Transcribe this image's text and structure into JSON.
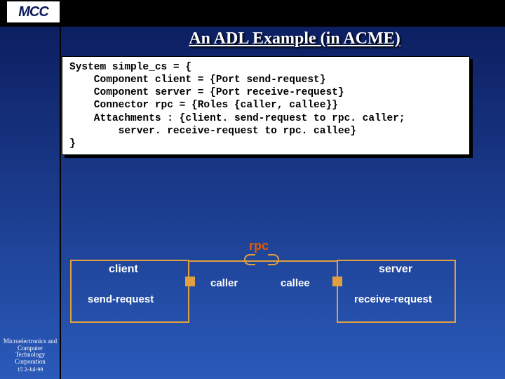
{
  "logo": "MCC",
  "title": "An ADL Example (in ACME)",
  "code": "System simple_cs = {\n    Component client = {Port send-request}\n    Component server = {Port receive-request}\n    Connector rpc = {Roles {caller, callee}}\n    Attachments : {client. send-request to rpc. caller;\n        server. receive-request to rpc. callee}\n}",
  "diagram": {
    "rpc": "rpc",
    "client": "client",
    "server": "server",
    "send": "send-request",
    "receive": "receive-request",
    "caller": "caller",
    "callee": "callee"
  },
  "footer": {
    "org": "Microelectronics and Computer Technology Corporation",
    "slidedate": "15 2-Jul-99"
  }
}
